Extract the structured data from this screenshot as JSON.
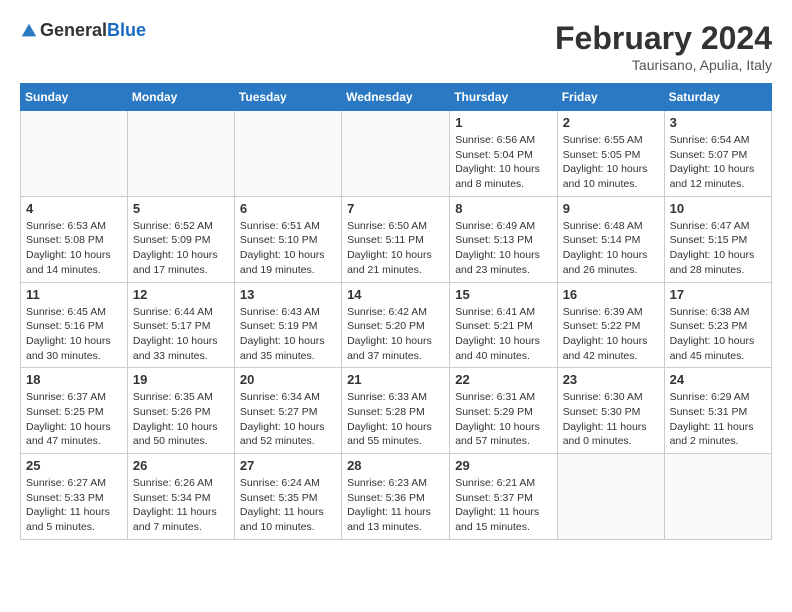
{
  "header": {
    "logo_general": "General",
    "logo_blue": "Blue",
    "title": "February 2024",
    "subtitle": "Taurisano, Apulia, Italy"
  },
  "weekdays": [
    "Sunday",
    "Monday",
    "Tuesday",
    "Wednesday",
    "Thursday",
    "Friday",
    "Saturday"
  ],
  "weeks": [
    [
      {
        "day": "",
        "sunrise": "",
        "sunset": "",
        "daylight": "",
        "empty": true
      },
      {
        "day": "",
        "sunrise": "",
        "sunset": "",
        "daylight": "",
        "empty": true
      },
      {
        "day": "",
        "sunrise": "",
        "sunset": "",
        "daylight": "",
        "empty": true
      },
      {
        "day": "",
        "sunrise": "",
        "sunset": "",
        "daylight": "",
        "empty": true
      },
      {
        "day": "1",
        "sunrise": "Sunrise: 6:56 AM",
        "sunset": "Sunset: 5:04 PM",
        "daylight": "Daylight: 10 hours and 8 minutes."
      },
      {
        "day": "2",
        "sunrise": "Sunrise: 6:55 AM",
        "sunset": "Sunset: 5:05 PM",
        "daylight": "Daylight: 10 hours and 10 minutes."
      },
      {
        "day": "3",
        "sunrise": "Sunrise: 6:54 AM",
        "sunset": "Sunset: 5:07 PM",
        "daylight": "Daylight: 10 hours and 12 minutes."
      }
    ],
    [
      {
        "day": "4",
        "sunrise": "Sunrise: 6:53 AM",
        "sunset": "Sunset: 5:08 PM",
        "daylight": "Daylight: 10 hours and 14 minutes."
      },
      {
        "day": "5",
        "sunrise": "Sunrise: 6:52 AM",
        "sunset": "Sunset: 5:09 PM",
        "daylight": "Daylight: 10 hours and 17 minutes."
      },
      {
        "day": "6",
        "sunrise": "Sunrise: 6:51 AM",
        "sunset": "Sunset: 5:10 PM",
        "daylight": "Daylight: 10 hours and 19 minutes."
      },
      {
        "day": "7",
        "sunrise": "Sunrise: 6:50 AM",
        "sunset": "Sunset: 5:11 PM",
        "daylight": "Daylight: 10 hours and 21 minutes."
      },
      {
        "day": "8",
        "sunrise": "Sunrise: 6:49 AM",
        "sunset": "Sunset: 5:13 PM",
        "daylight": "Daylight: 10 hours and 23 minutes."
      },
      {
        "day": "9",
        "sunrise": "Sunrise: 6:48 AM",
        "sunset": "Sunset: 5:14 PM",
        "daylight": "Daylight: 10 hours and 26 minutes."
      },
      {
        "day": "10",
        "sunrise": "Sunrise: 6:47 AM",
        "sunset": "Sunset: 5:15 PM",
        "daylight": "Daylight: 10 hours and 28 minutes."
      }
    ],
    [
      {
        "day": "11",
        "sunrise": "Sunrise: 6:45 AM",
        "sunset": "Sunset: 5:16 PM",
        "daylight": "Daylight: 10 hours and 30 minutes."
      },
      {
        "day": "12",
        "sunrise": "Sunrise: 6:44 AM",
        "sunset": "Sunset: 5:17 PM",
        "daylight": "Daylight: 10 hours and 33 minutes."
      },
      {
        "day": "13",
        "sunrise": "Sunrise: 6:43 AM",
        "sunset": "Sunset: 5:19 PM",
        "daylight": "Daylight: 10 hours and 35 minutes."
      },
      {
        "day": "14",
        "sunrise": "Sunrise: 6:42 AM",
        "sunset": "Sunset: 5:20 PM",
        "daylight": "Daylight: 10 hours and 37 minutes."
      },
      {
        "day": "15",
        "sunrise": "Sunrise: 6:41 AM",
        "sunset": "Sunset: 5:21 PM",
        "daylight": "Daylight: 10 hours and 40 minutes."
      },
      {
        "day": "16",
        "sunrise": "Sunrise: 6:39 AM",
        "sunset": "Sunset: 5:22 PM",
        "daylight": "Daylight: 10 hours and 42 minutes."
      },
      {
        "day": "17",
        "sunrise": "Sunrise: 6:38 AM",
        "sunset": "Sunset: 5:23 PM",
        "daylight": "Daylight: 10 hours and 45 minutes."
      }
    ],
    [
      {
        "day": "18",
        "sunrise": "Sunrise: 6:37 AM",
        "sunset": "Sunset: 5:25 PM",
        "daylight": "Daylight: 10 hours and 47 minutes."
      },
      {
        "day": "19",
        "sunrise": "Sunrise: 6:35 AM",
        "sunset": "Sunset: 5:26 PM",
        "daylight": "Daylight: 10 hours and 50 minutes."
      },
      {
        "day": "20",
        "sunrise": "Sunrise: 6:34 AM",
        "sunset": "Sunset: 5:27 PM",
        "daylight": "Daylight: 10 hours and 52 minutes."
      },
      {
        "day": "21",
        "sunrise": "Sunrise: 6:33 AM",
        "sunset": "Sunset: 5:28 PM",
        "daylight": "Daylight: 10 hours and 55 minutes."
      },
      {
        "day": "22",
        "sunrise": "Sunrise: 6:31 AM",
        "sunset": "Sunset: 5:29 PM",
        "daylight": "Daylight: 10 hours and 57 minutes."
      },
      {
        "day": "23",
        "sunrise": "Sunrise: 6:30 AM",
        "sunset": "Sunset: 5:30 PM",
        "daylight": "Daylight: 11 hours and 0 minutes."
      },
      {
        "day": "24",
        "sunrise": "Sunrise: 6:29 AM",
        "sunset": "Sunset: 5:31 PM",
        "daylight": "Daylight: 11 hours and 2 minutes."
      }
    ],
    [
      {
        "day": "25",
        "sunrise": "Sunrise: 6:27 AM",
        "sunset": "Sunset: 5:33 PM",
        "daylight": "Daylight: 11 hours and 5 minutes."
      },
      {
        "day": "26",
        "sunrise": "Sunrise: 6:26 AM",
        "sunset": "Sunset: 5:34 PM",
        "daylight": "Daylight: 11 hours and 7 minutes."
      },
      {
        "day": "27",
        "sunrise": "Sunrise: 6:24 AM",
        "sunset": "Sunset: 5:35 PM",
        "daylight": "Daylight: 11 hours and 10 minutes."
      },
      {
        "day": "28",
        "sunrise": "Sunrise: 6:23 AM",
        "sunset": "Sunset: 5:36 PM",
        "daylight": "Daylight: 11 hours and 13 minutes."
      },
      {
        "day": "29",
        "sunrise": "Sunrise: 6:21 AM",
        "sunset": "Sunset: 5:37 PM",
        "daylight": "Daylight: 11 hours and 15 minutes."
      },
      {
        "day": "",
        "sunrise": "",
        "sunset": "",
        "daylight": "",
        "empty": true
      },
      {
        "day": "",
        "sunrise": "",
        "sunset": "",
        "daylight": "",
        "empty": true
      }
    ]
  ]
}
